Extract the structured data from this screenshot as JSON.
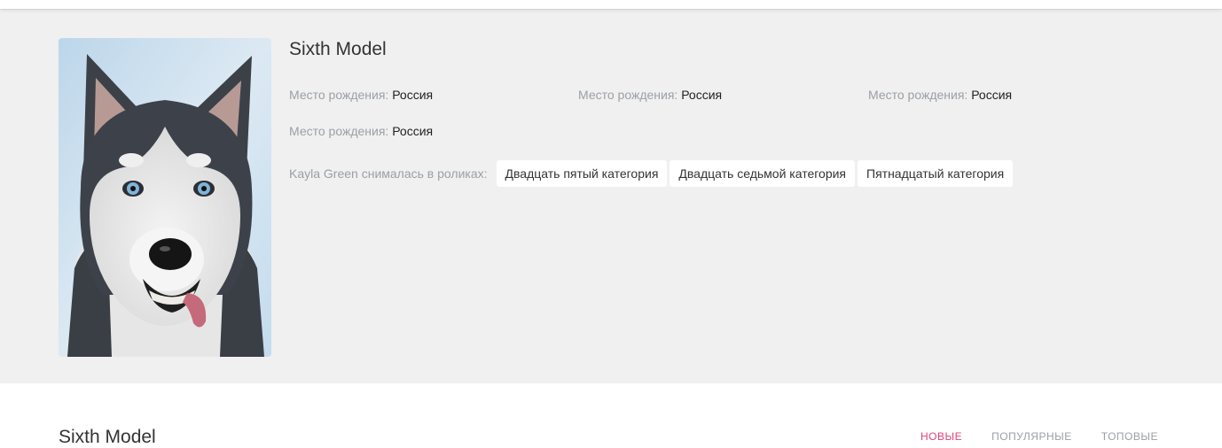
{
  "profile": {
    "name": "Sixth Model",
    "photo_alt": "dog-photo",
    "fields": [
      {
        "label": "Место рождения:",
        "value": "Россия"
      },
      {
        "label": "Место рождения:",
        "value": "Россия"
      },
      {
        "label": "Место рождения:",
        "value": "Россия"
      },
      {
        "label": "Место рождения:",
        "value": "Россия"
      }
    ],
    "roles_label": "Kayla Green снималась в роликах:",
    "categories": [
      "Двадцать пятый категория",
      "Двадцать седьмой категория",
      "Пятнадцатый категория"
    ]
  },
  "videos": {
    "title": "Sixth Model",
    "tabs": [
      "НОВЫЕ",
      "ПОПУЛЯРНЫЕ",
      "ТОПОВЫЕ"
    ],
    "active_tab": "НОВЫЕ"
  },
  "colors": {
    "profile_bg": "#f0f0f0",
    "accent": "#e0427a",
    "muted": "#9aa0a6"
  }
}
